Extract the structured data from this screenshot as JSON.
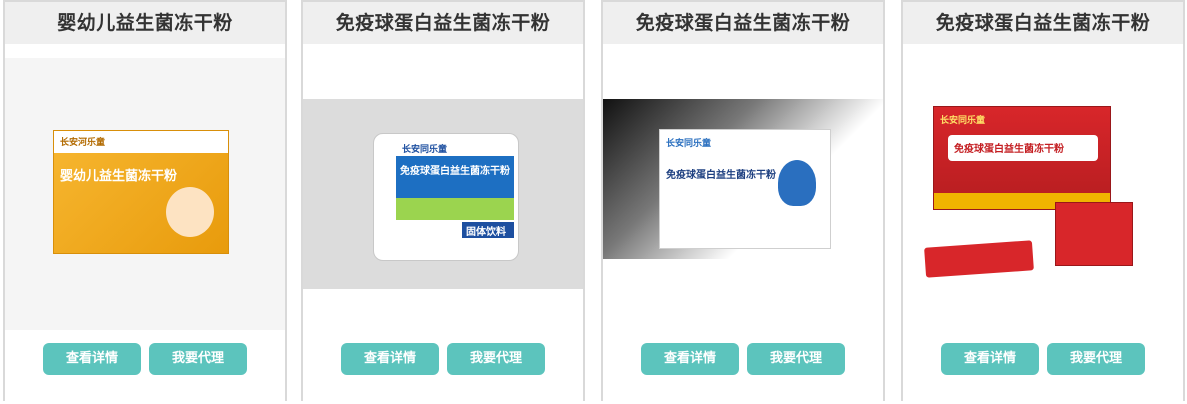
{
  "colors": {
    "card_border": "#d9d9d9",
    "title_bg": "#efefef",
    "button_bg": "#5cc4bd",
    "button_text": "#ffffff"
  },
  "products": [
    {
      "title": "婴幼儿益生菌冻干粉",
      "detail_label": "查看详情",
      "agent_label": "我要代理",
      "package_text": "婴幼儿益生菌冻干粉",
      "brand_text": "长安河乐童",
      "image_bg": "#ffffff"
    },
    {
      "title": "免疫球蛋白益生菌冻干粉",
      "detail_label": "查看详情",
      "agent_label": "我要代理",
      "package_text": "免疫球蛋白益生菌冻干粉",
      "brand_text": "长安同乐童",
      "badge_text": "固体饮料",
      "image_bg": "#dcdcdc"
    },
    {
      "title": "免疫球蛋白益生菌冻干粉",
      "detail_label": "查看详情",
      "agent_label": "我要代理",
      "package_text": "免疫球蛋白益生菌冻干粉",
      "brand_text": "长安同乐童",
      "image_bg": "#000000"
    },
    {
      "title": "免疫球蛋白益生菌冻干粉",
      "detail_label": "查看详情",
      "agent_label": "我要代理",
      "package_text": "免疫球蛋白益生菌冻干粉",
      "brand_text": "长安同乐童",
      "image_bg": "#ffffff"
    }
  ]
}
